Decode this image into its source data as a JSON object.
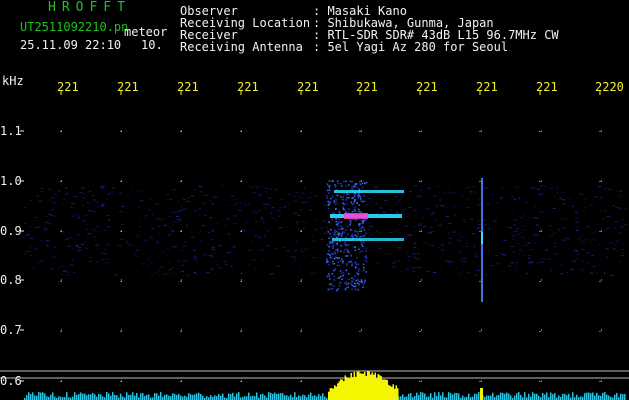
{
  "header": {
    "title": "HROFFT",
    "filename": "UT2511092210.pn",
    "filename_suffix": "meteor",
    "datetime": "25.11.09 22:10",
    "seconds": "10.",
    "info": [
      {
        "label": "Observer",
        "value": ": Masaki Kano"
      },
      {
        "label": "Receiving Location",
        "value": ": Shibukawa, Gunma, Japan"
      },
      {
        "label": "Receiver",
        "value": ": RTL-SDR SDR# 43dB L15 96.7MHz CW"
      },
      {
        "label": "Receiving Antenna",
        "value": ": 5el Yagi Az 280 for Seoul"
      }
    ]
  },
  "time_axis": {
    "labels": [
      "221",
      "221",
      "221",
      "221",
      "221",
      "221",
      "221",
      "221",
      "221",
      "2220"
    ]
  },
  "freq_axis": {
    "unit": "kHz",
    "labels": [
      "1.1",
      "1.0",
      "0.9",
      "0.8",
      "0.7",
      "0.6"
    ]
  },
  "colors": {
    "background": "#000000",
    "grid_yellow": "#f5ef2a",
    "text_white": "#f2f2f2",
    "title_green": "#1ec41e",
    "noise_blue": "#1a2a9a",
    "echo_cyan": "#30e0ff",
    "echo_magenta": "#ff40d0"
  }
}
